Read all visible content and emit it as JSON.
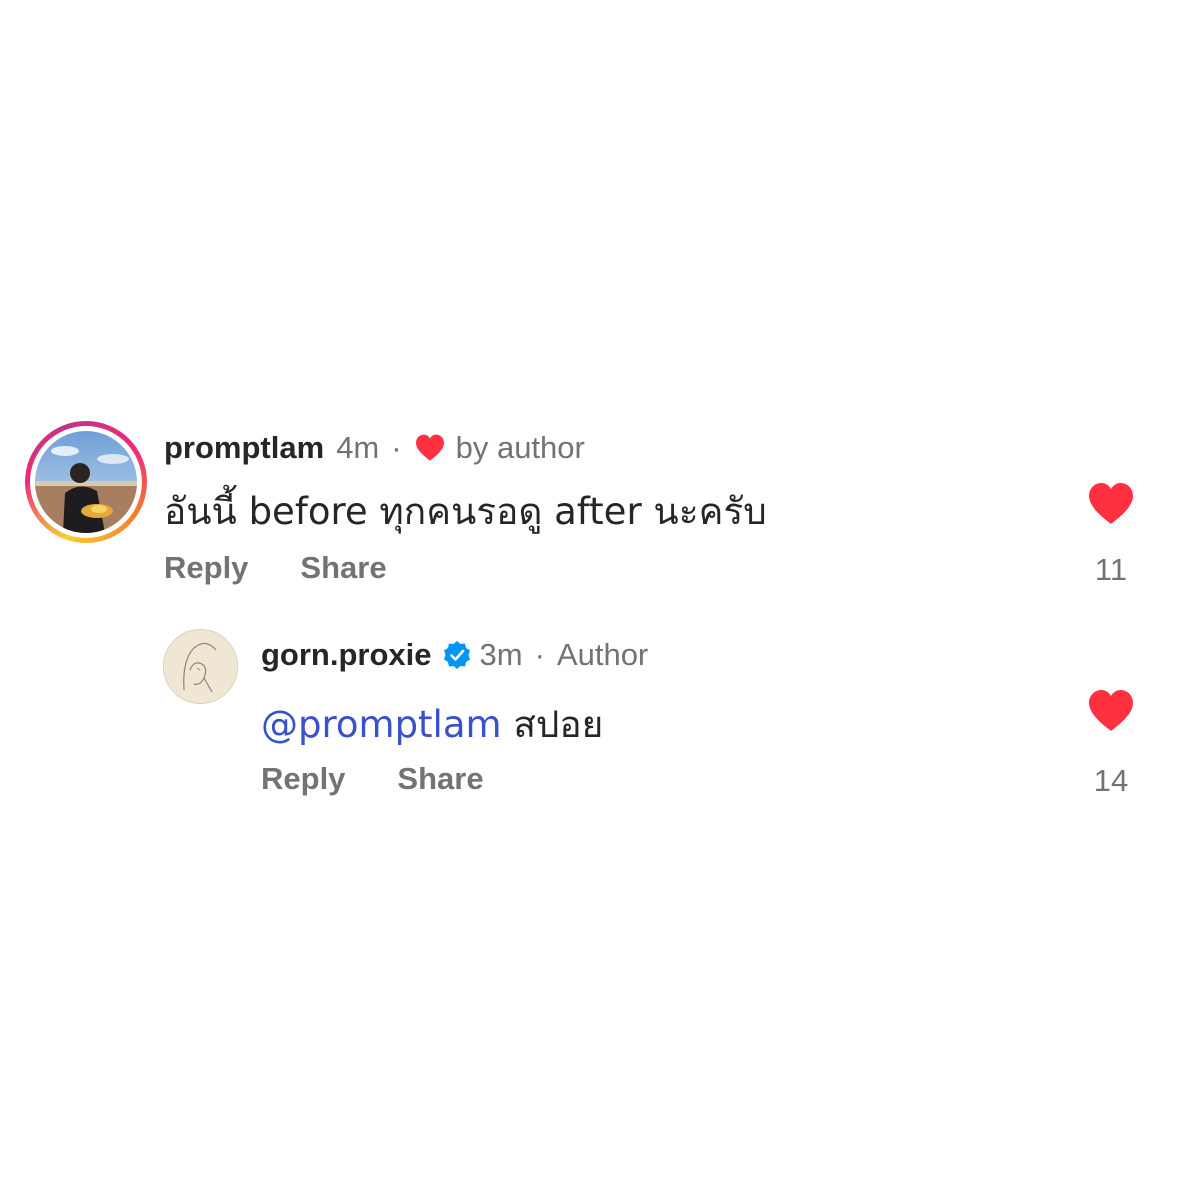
{
  "comments": [
    {
      "username": "promptlam",
      "time": "4m",
      "separator": "·",
      "liked_by_author_label": "by author",
      "text": "อันนี้ before ทุกคนรอดู after นะครับ",
      "reply_label": "Reply",
      "share_label": "Share",
      "like_count": "11",
      "avatar_icon": "profile-photo-icon",
      "like_icon": "heart-filled-icon"
    }
  ],
  "replies": [
    {
      "username": "gorn.proxie",
      "verified": true,
      "time": "3m",
      "separator": "·",
      "role_label": "Author",
      "mention": "@promptlam",
      "text": "สปอย",
      "reply_label": "Reply",
      "share_label": "Share",
      "like_count": "14",
      "avatar_icon": "line-drawing-avatar-icon",
      "like_icon": "heart-filled-icon"
    }
  ],
  "colors": {
    "like_red": "#ff3040",
    "verified_blue": "#0095f6",
    "mention_blue": "#3b50c9",
    "text_primary": "#262626",
    "text_secondary": "#737373"
  }
}
